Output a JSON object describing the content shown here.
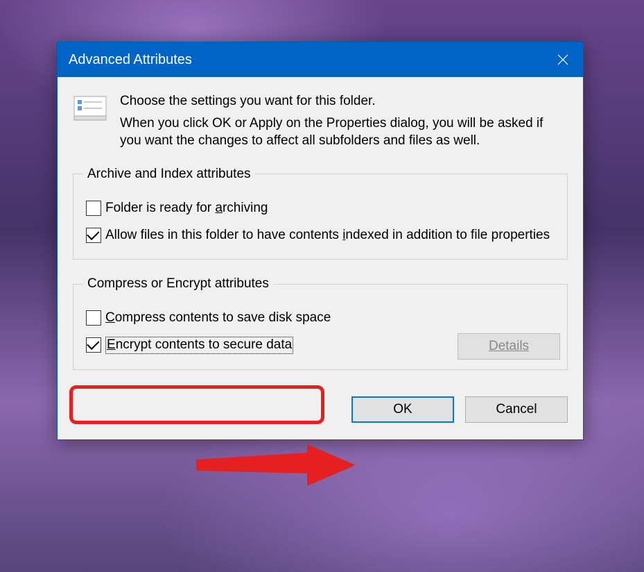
{
  "dialog": {
    "title": "Advanced Attributes",
    "header_line1": "Choose the settings you want for this folder.",
    "header_line2": "When you click OK or Apply on the Properties dialog, you will be asked if you want the changes to affect all subfolders and files as well."
  },
  "archive_group": {
    "legend": "Archive and Index attributes",
    "archive_label_pre": "Folder is ready for ",
    "archive_label_u": "a",
    "archive_label_post": "rchiving",
    "archive_checked": false,
    "index_label_pre": "Allow files in this folder to have contents ",
    "index_label_u": "i",
    "index_label_post": "ndexed in addition to file properties",
    "index_checked": true
  },
  "compress_group": {
    "legend": "Compress or Encrypt attributes",
    "compress_label_u": "C",
    "compress_label_post": "ompress contents to save disk space",
    "compress_checked": false,
    "encrypt_label_u": "E",
    "encrypt_label_post": "ncrypt contents to secure data",
    "encrypt_checked": true,
    "details_label_u": "D",
    "details_label_post": "etails"
  },
  "buttons": {
    "ok": "OK",
    "cancel": "Cancel"
  }
}
